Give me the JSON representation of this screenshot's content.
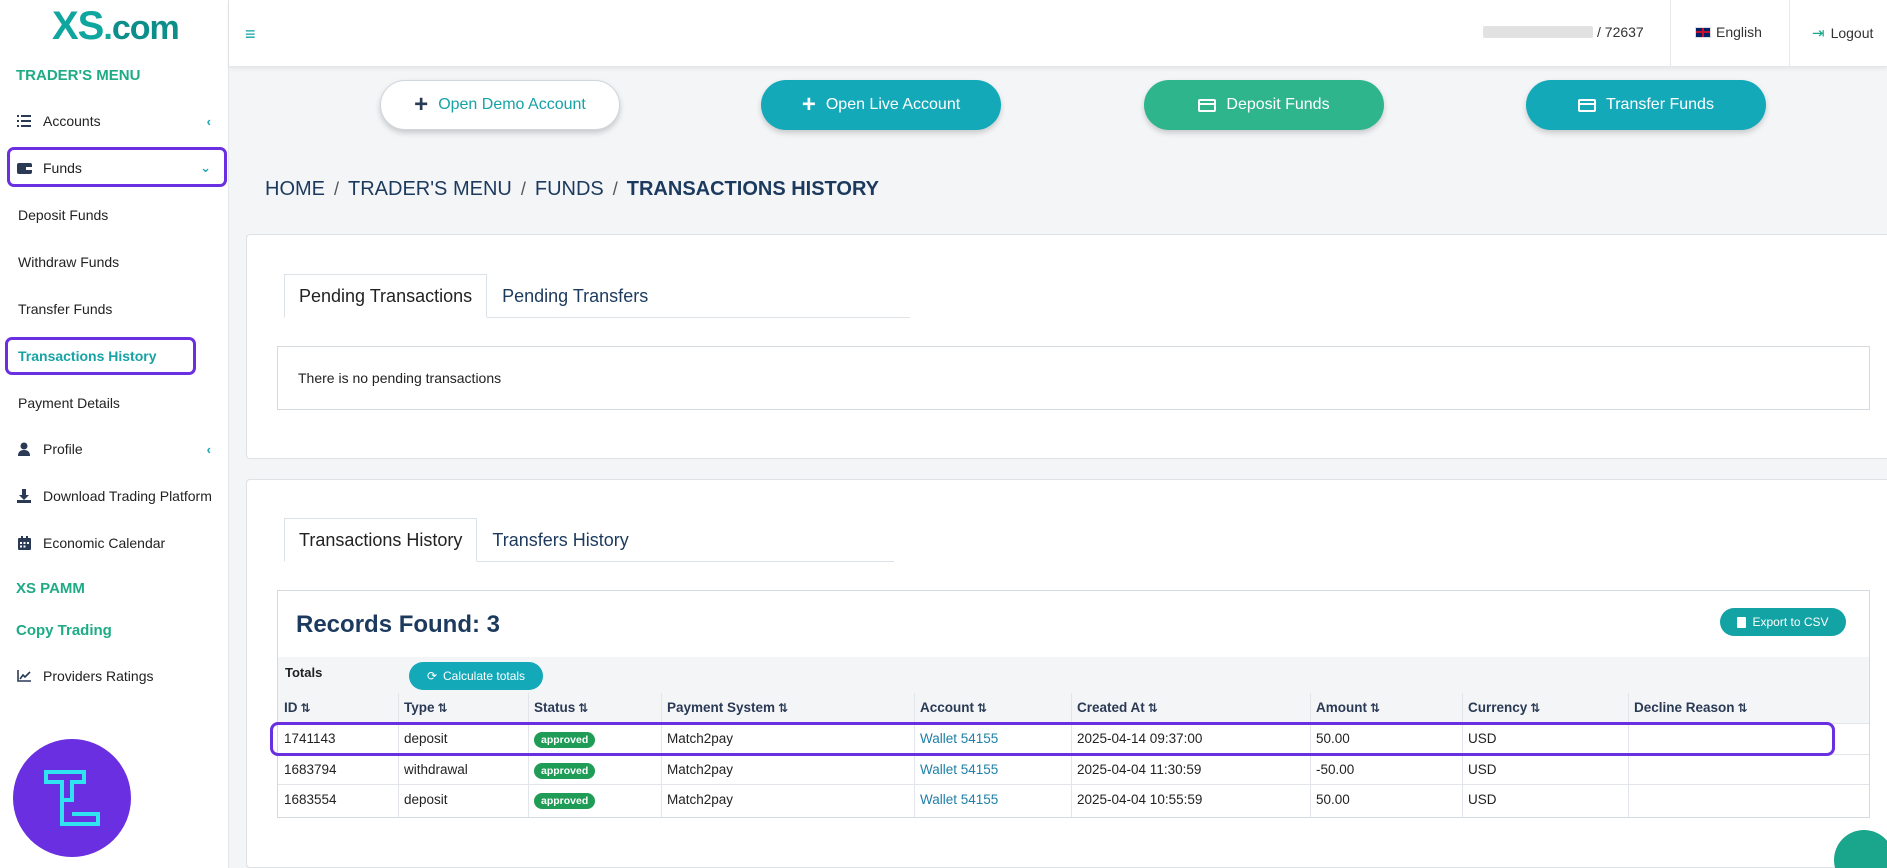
{
  "brand": {
    "logo_x": "XS",
    "logo_dot": ".",
    "logo_com": "com"
  },
  "sidebar": {
    "section_traders_menu": "TRADER'S MENU",
    "accounts": "Accounts",
    "funds": "Funds",
    "deposit_funds": "Deposit Funds",
    "withdraw_funds": "Withdraw Funds",
    "transfer_funds": "Transfer Funds",
    "transactions_history": "Transactions History",
    "payment_details": "Payment Details",
    "profile": "Profile",
    "download_platform": "Download Trading Platform",
    "economic_calendar": "Economic Calendar",
    "section_xs_pamm": "XS PAMM",
    "section_copy_trading": "Copy Trading",
    "providers_ratings": "Providers Ratings"
  },
  "topbar": {
    "account_suffix": "/ 72637",
    "language": "English",
    "logout": "Logout"
  },
  "actions": {
    "open_demo": "Open Demo Account",
    "open_live": "Open Live Account",
    "deposit": "Deposit Funds",
    "transfer": "Transfer Funds"
  },
  "breadcrumb": {
    "home": "HOME",
    "traders_menu": "TRADER'S MENU",
    "funds": "FUNDS",
    "current": "TRANSACTIONS HISTORY",
    "sep": "/"
  },
  "pending": {
    "tab_transactions": "Pending Transactions",
    "tab_transfers": "Pending Transfers",
    "empty_message": "There is no pending transactions"
  },
  "history": {
    "tab_transactions": "Transactions History",
    "tab_transfers": "Transfers History",
    "records_found": "Records Found: 3",
    "export_csv": "Export to CSV",
    "totals_label": "Totals",
    "calculate_totals": "Calculate totals",
    "columns": [
      "ID",
      "Type",
      "Status",
      "Payment System",
      "Account",
      "Created At",
      "Amount",
      "Currency",
      "Decline Reason"
    ],
    "rows": [
      {
        "id": "1741143",
        "type": "deposit",
        "status": "approved",
        "payment_system": "Match2pay",
        "account": "Wallet 54155",
        "created_at": "2025-04-14 09:37:00",
        "amount": "50.00",
        "currency": "USD",
        "decline_reason": ""
      },
      {
        "id": "1683794",
        "type": "withdrawal",
        "status": "approved",
        "payment_system": "Match2pay",
        "account": "Wallet 54155",
        "created_at": "2025-04-04 11:30:59",
        "amount": "-50.00",
        "currency": "USD",
        "decline_reason": ""
      },
      {
        "id": "1683554",
        "type": "deposit",
        "status": "approved",
        "payment_system": "Match2pay",
        "account": "Wallet 54155",
        "created_at": "2025-04-04 10:55:59",
        "amount": "50.00",
        "currency": "USD",
        "decline_reason": ""
      }
    ]
  },
  "colors": {
    "accent_teal": "#13a9b9",
    "accent_green": "#2fb58c",
    "highlight_purple": "#6a2fe0",
    "approved": "#1f9d57"
  }
}
